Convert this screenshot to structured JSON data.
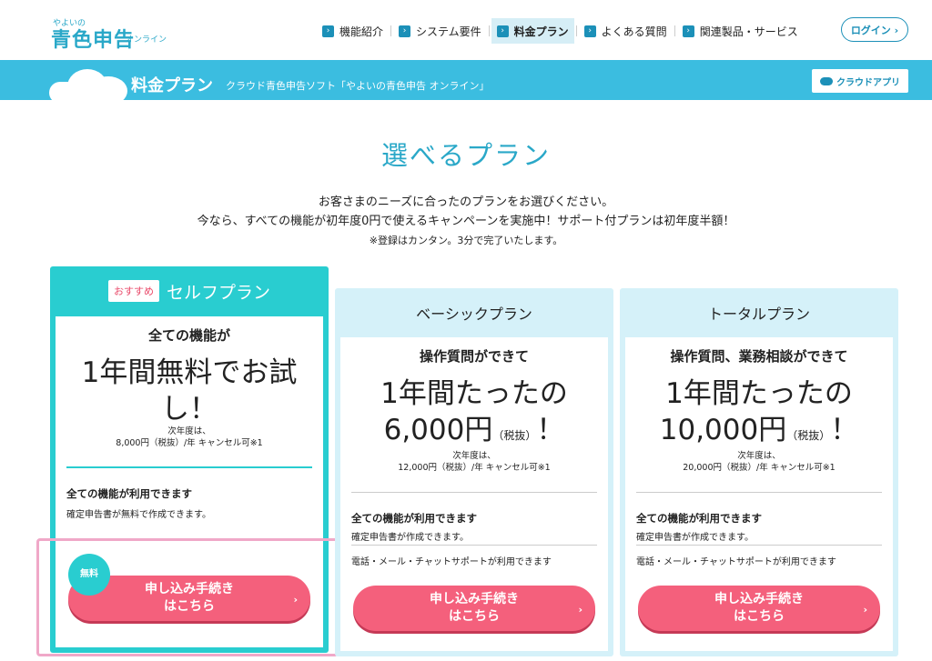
{
  "header": {
    "logo": {
      "small": "やよいの",
      "main": "青色申告",
      "sub": "オンライン"
    },
    "nav": [
      {
        "label": "機能紹介"
      },
      {
        "label": "システム要件"
      },
      {
        "label": "料金プラン"
      },
      {
        "label": "よくある質問"
      },
      {
        "label": "関連製品・サービス"
      }
    ],
    "login_label": "ログイン ›"
  },
  "banner": {
    "title": "料金プラン",
    "subtitle": "クラウド青色申告ソフト「やよいの青色申告 オンライン」",
    "cloud_app_label": "クラウドアプリ"
  },
  "main": {
    "title": "選べるプラン",
    "intro1": "お客さまのニーズに合ったのプランをお選びください。",
    "intro2": "今なら、すべての機能が初年度0円で使えるキャンペーンを実施中！サポート付プランは初年度半額！",
    "intro3": "※登録はカンタン。3分で完了いたします。"
  },
  "plans": {
    "self": {
      "tag": "おすすめ",
      "name": "セルフプラン",
      "head": "全ての機能が",
      "big1": "1年間無料でお試",
      "big2": "し！",
      "note1": "次年度は、",
      "note2": "8,000円（税抜）/年 キャンセル可※1",
      "feature_title": "全ての機能が利用できます",
      "feature_text": "確定申告書が無料で作成できます。",
      "badge": "無料",
      "btn1": "申し込み手続き",
      "btn2": "はこちら"
    },
    "basic": {
      "name": "ベーシックプラン",
      "head": "操作質問ができて",
      "big1": "1年間たったの",
      "price": "6,000円",
      "tax": "（税抜）",
      "excl": "！",
      "note1": "次年度は、",
      "note2": "12,000円（税抜）/年 キャンセル可※1",
      "feature_title": "全ての機能が利用できます",
      "feature_text": "確定申告書が作成できます。",
      "support_text": "電話・メール・チャットサポートが利用できます",
      "btn1": "申し込み手続き",
      "btn2": "はこちら"
    },
    "total": {
      "name": "トータルプラン",
      "head": "操作質問、業務相談ができて",
      "big1": "1年間たったの",
      "price": "10,000円",
      "tax": "（税抜）",
      "excl": "！",
      "note1": "次年度は、",
      "note2": "20,000円（税抜）/年 キャンセル可※1",
      "feature_title": "全ての機能が利用できます",
      "feature_text": "確定申告書が作成できます。",
      "support_text": "電話・メール・チャットサポートが利用できます",
      "btn1": "申し込み手続き",
      "btn2": "はこちら"
    }
  }
}
